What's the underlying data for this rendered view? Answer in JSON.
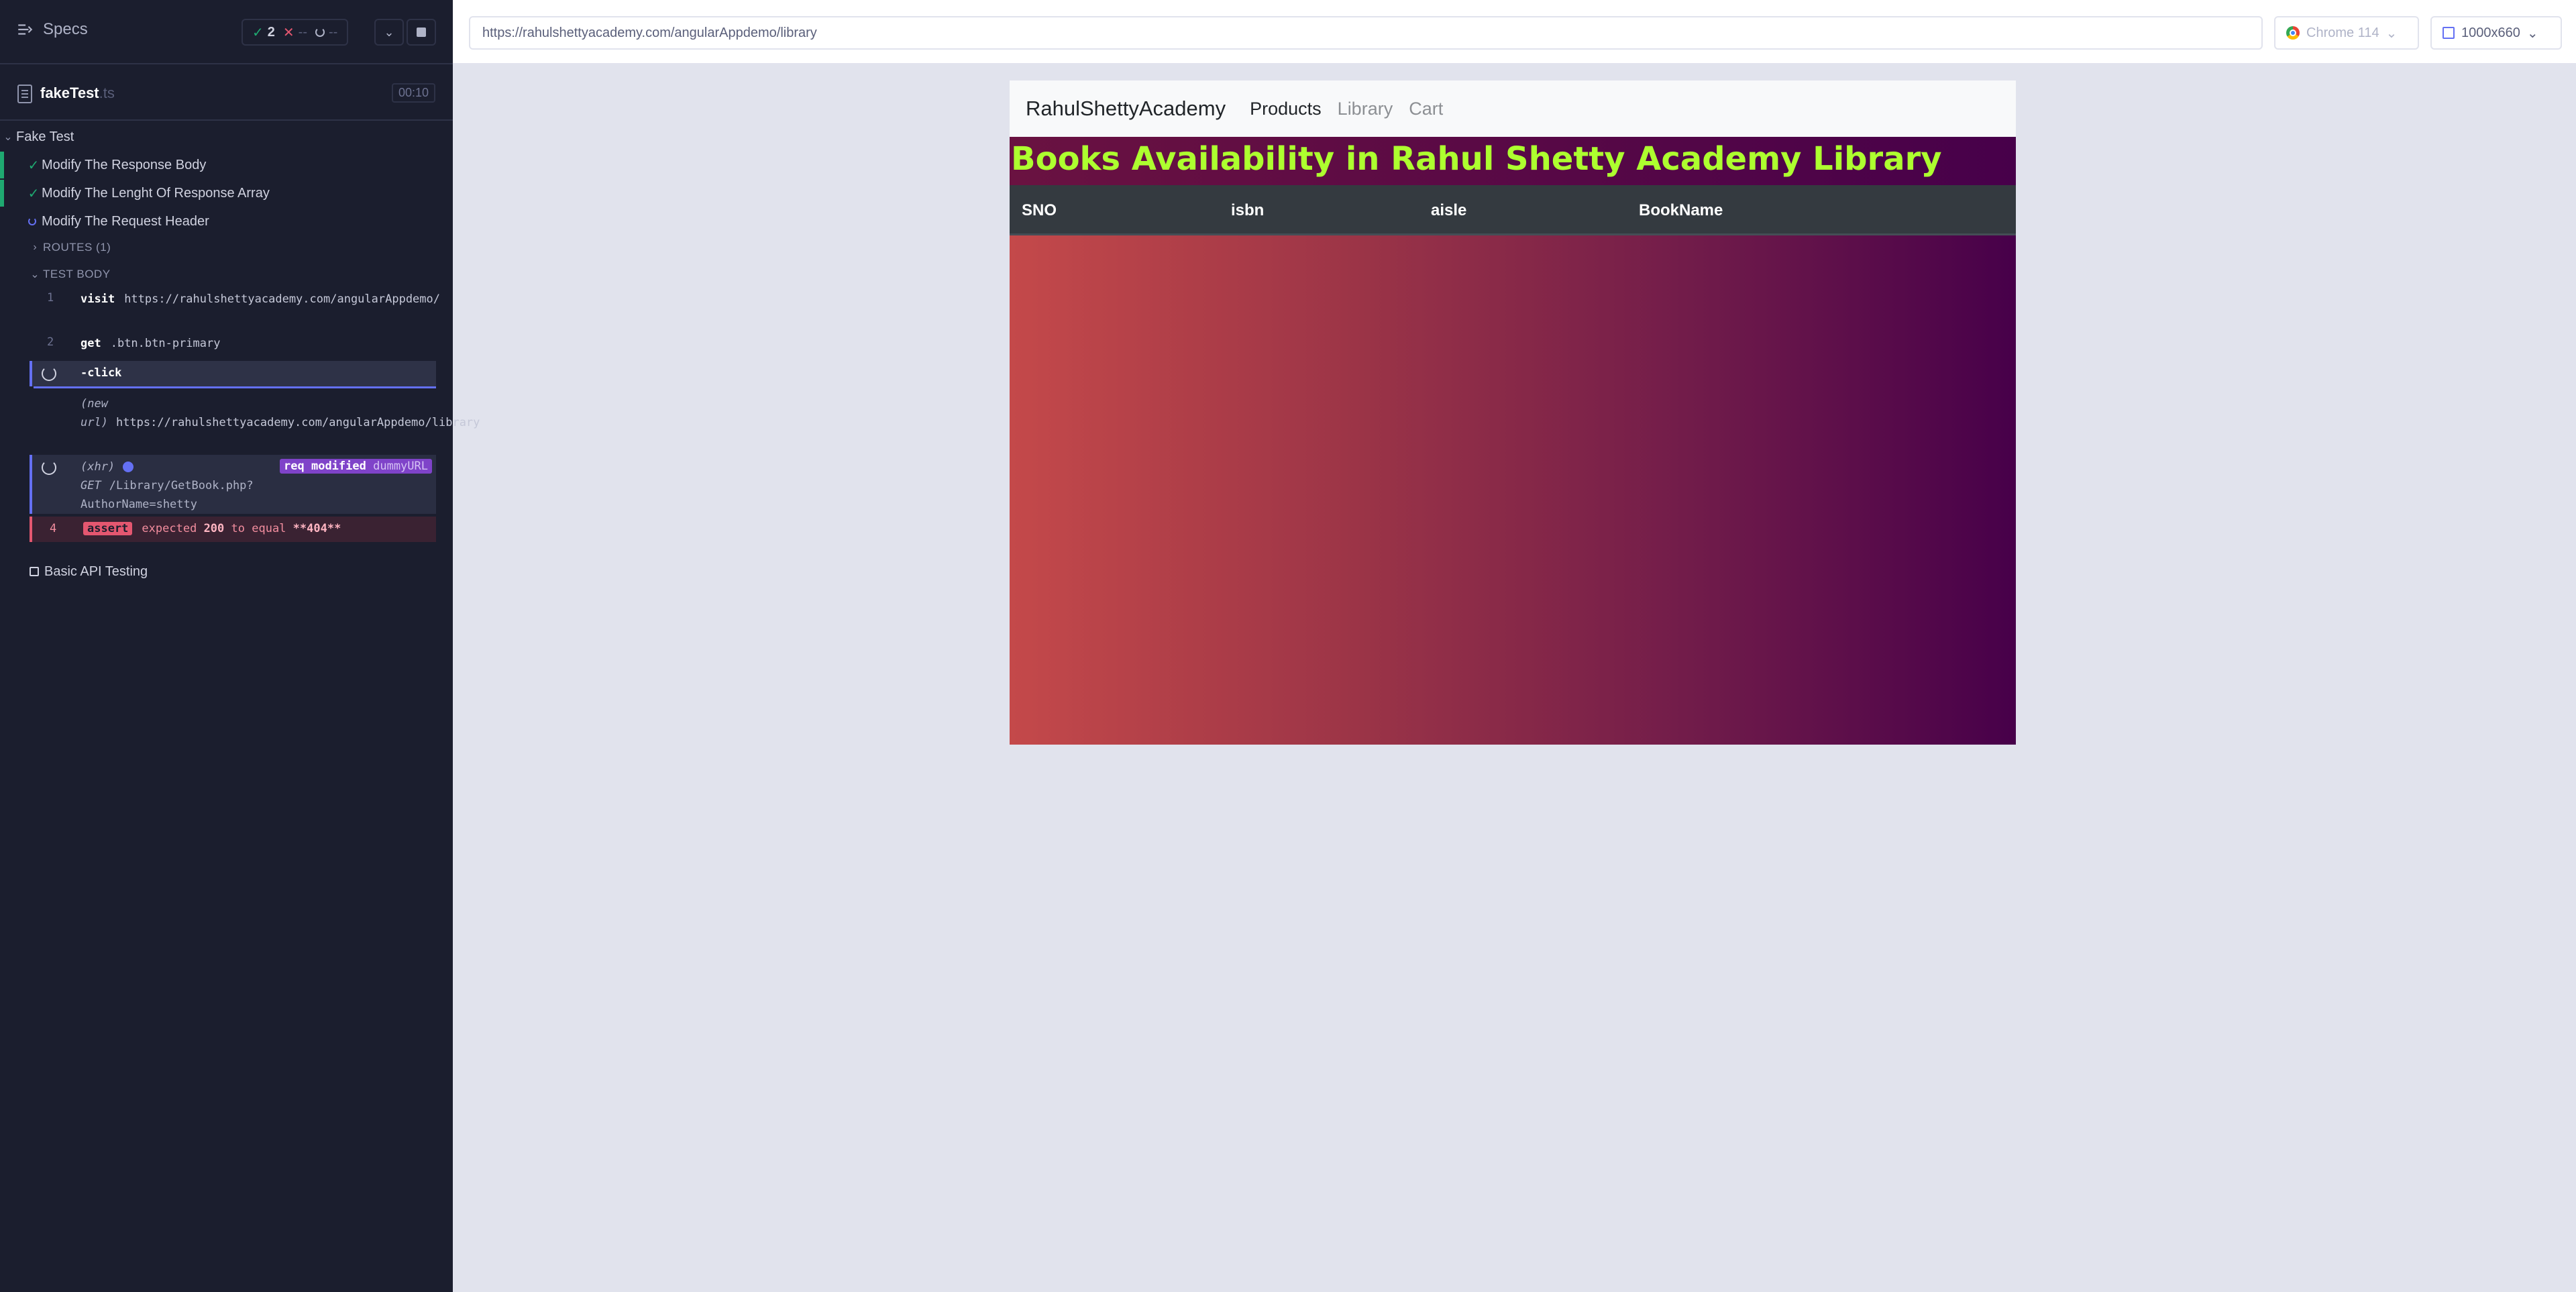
{
  "sidebar": {
    "specs_label": "Specs",
    "stats": {
      "passed": "2",
      "failed_placeholder": "--",
      "pending_placeholder": "--"
    },
    "file": {
      "name": "fakeTest",
      "ext": ".ts",
      "duration": "00:10"
    },
    "suite": "Fake Test",
    "tests": [
      {
        "title": "Modify The Response Body",
        "state": "passed"
      },
      {
        "title": "Modify The Lenght Of Response Array",
        "state": "passed"
      },
      {
        "title": "Modify The Request Header",
        "state": "running"
      }
    ],
    "routes_label": "ROUTES (1)",
    "test_body_label": "TEST BODY",
    "commands": {
      "visit": {
        "num": "1",
        "name": "visit",
        "msg": "https://rahulshettyacademy.com/angularAppdemo/"
      },
      "get": {
        "num": "2",
        "name": "get",
        "msg": ".btn.btn-primary"
      },
      "click": {
        "name": "-click"
      },
      "newurl": {
        "label": "(new url)",
        "msg": "https://rahulshettyacademy.com/angularAppdemo/library"
      },
      "xhr": {
        "label": "(xhr)",
        "method": "GET",
        "path": "/Library/GetBook.php?AuthorName=shetty",
        "badge": "req modified",
        "badge_alias": "dummyURL"
      },
      "assert": {
        "num": "4",
        "name": "assert",
        "text1": "expected",
        "val1": "200",
        "text2": "to equal",
        "val2": "**404**"
      }
    },
    "other_test": "Basic API Testing"
  },
  "urlbar": {
    "url": "https://rahulshettyacademy.com/angularAppdemo/library",
    "browser": "Chrome 114",
    "viewport": "1000x660"
  },
  "app": {
    "brand": "RahulShettyAcademy",
    "nav": [
      "Products",
      "Library",
      "Cart"
    ],
    "heading": "Books Availability in Rahul Shetty Academy Library",
    "columns": [
      "SNO",
      "isbn",
      "aisle",
      "BookName"
    ]
  }
}
